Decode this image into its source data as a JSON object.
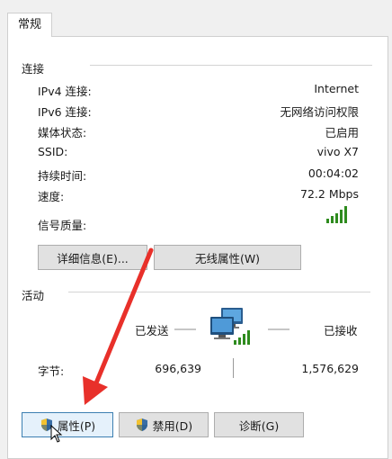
{
  "tabs": [
    {
      "label": "常规"
    }
  ],
  "connection": {
    "title": "连接",
    "rows": [
      {
        "label": "IPv4 连接:",
        "value": "Internet"
      },
      {
        "label": "IPv6 连接:",
        "value": "无网络访问权限"
      },
      {
        "label": "媒体状态:",
        "value": "已启用"
      },
      {
        "label": "SSID:",
        "value": "vivo X7"
      },
      {
        "label": "持续时间:",
        "value": "00:04:02"
      },
      {
        "label": "速度:",
        "value": "72.2 Mbps"
      }
    ],
    "signal_label": "信号质量:",
    "signal_bars": 5,
    "buttons": {
      "details": "详细信息(E)...",
      "wireless": "无线属性(W)"
    }
  },
  "activity": {
    "title": "活动",
    "sent_label": "已发送",
    "received_label": "已接收",
    "bytes_label": "字节:",
    "bytes_sent": "696,639",
    "bytes_received": "1,576,629"
  },
  "bottom_buttons": {
    "properties": "属性(P)",
    "disable": "禁用(D)",
    "diagnose": "诊断(G)"
  },
  "colors": {
    "accent": "#3c7fb1",
    "signal_green": "#2e8b1e",
    "arrow_red": "#e8302a"
  }
}
